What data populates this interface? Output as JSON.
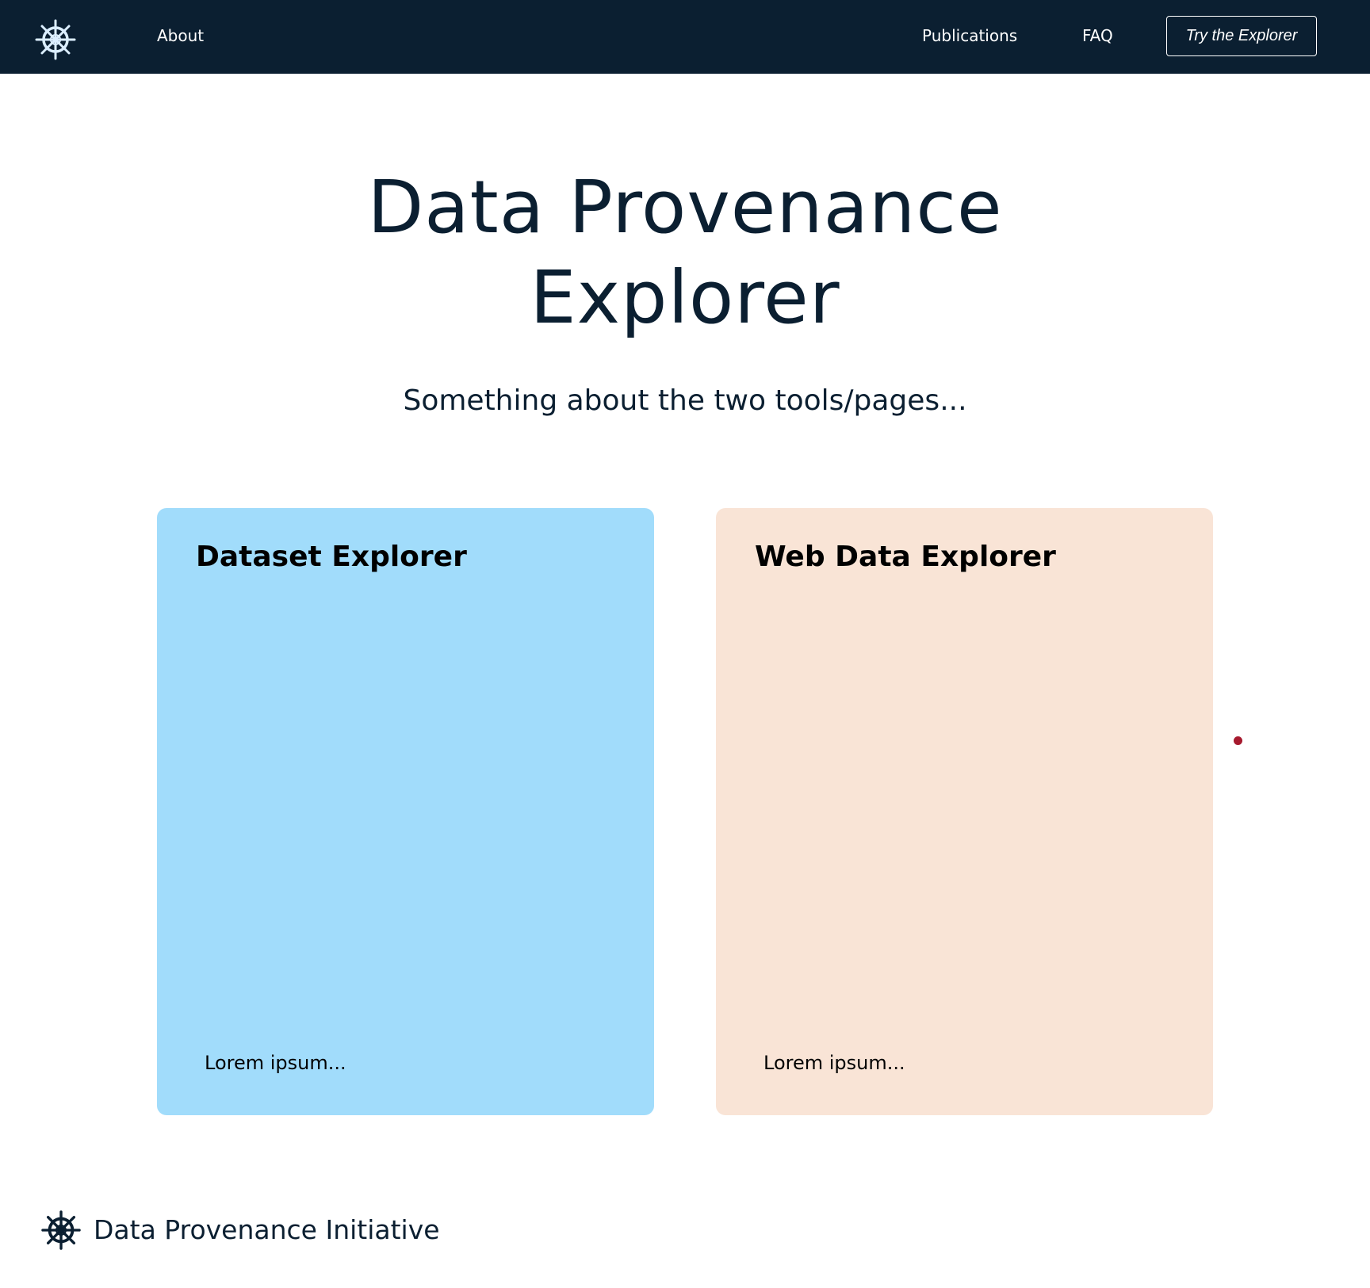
{
  "navbar": {
    "logo_icon": "ship-wheel-icon",
    "links": {
      "about": "About",
      "publications": "Publications",
      "faq": "FAQ"
    },
    "cta_label": "Try the Explorer"
  },
  "hero": {
    "title_line1": "Data Provenance",
    "title_line2": "Explorer",
    "subtitle": "Something about the two tools/pages..."
  },
  "cards": [
    {
      "title": "Dataset Explorer",
      "body": "Lorem ipsum...",
      "color": "#a1dcfb"
    },
    {
      "title": "Web Data Explorer",
      "body": "Lorem ipsum...",
      "color": "#f9e4d6"
    }
  ],
  "footer": {
    "logo_icon": "ship-wheel-icon",
    "brand_name": "Data Provenance Initiative"
  },
  "colors": {
    "navbar_bg": "#0b1f31",
    "text": "#0b1f31",
    "accent_dot": "#a6192e"
  }
}
